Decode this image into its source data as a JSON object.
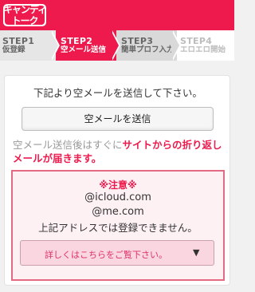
{
  "header": {
    "logo_line1": "キャンディ",
    "logo_line2": "トーク",
    "brand_color": "#ee1a4d"
  },
  "steps": [
    {
      "num": "STEP1",
      "label": "仮登録",
      "state": "done"
    },
    {
      "num": "STEP2",
      "label": "空メール送信",
      "state": "current"
    },
    {
      "num": "STEP3",
      "label": "簡単プロフ入力",
      "state": "upcoming"
    },
    {
      "num": "STEP4",
      "label": "エロエロ開始",
      "state": "upcoming"
    }
  ],
  "main": {
    "instruction": "下記より空メールを送信して下さい。",
    "send_button_label": "空メールを送信",
    "notice_prefix": "空メール送信後はすぐに",
    "notice_emphasis": "サイトからの折り返しメールが届きます。"
  },
  "warning": {
    "title": "※注意※",
    "domain1": "@icloud.com",
    "domain2": "@me.com",
    "message": "上記アドレスでは登録できません。",
    "details_label": "詳しくはこちらをご覧下さい。",
    "details_icon": "caret-down-icon",
    "details_arrow": "▼",
    "accent_color": "#e36a82"
  }
}
